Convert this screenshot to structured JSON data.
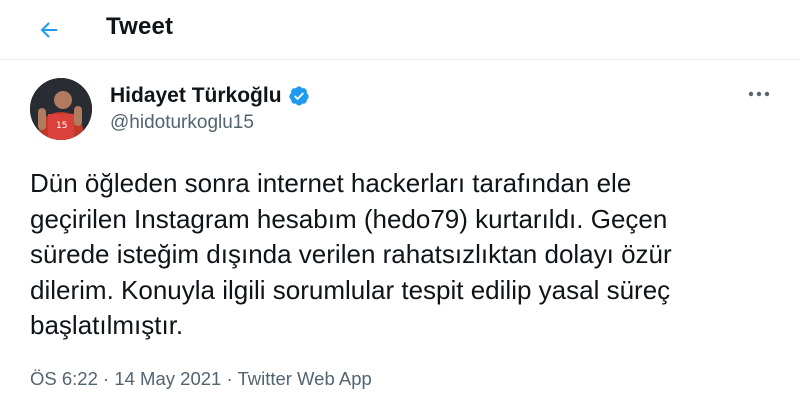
{
  "header": {
    "back_icon": "arrow-left-icon",
    "title": "Tweet",
    "accent_color": "#1d9bf0"
  },
  "tweet": {
    "author": {
      "name": "Hidayet Türkoğlu",
      "handle": "@hidoturkoglu15",
      "verified": true,
      "verified_icon": "verified-badge-icon"
    },
    "more_icon": "more-horizontal-icon",
    "text_lines": [
      "Dün öğleden sonra internet hackerları tarafından ele",
      "geçirilen Instagram hesabım (hedo79) kurtarıldı. Geçen",
      "sürede isteğim dışında verilen rahatsızlıktan dolayı özür",
      "dilerim. Konuyla ilgili sorumlular tespit edilip yasal süreç",
      "başlatılmıştır."
    ],
    "time": "ÖS 6:22",
    "separator": "·",
    "date": "14 May 2021",
    "source": "Twitter Web App"
  }
}
